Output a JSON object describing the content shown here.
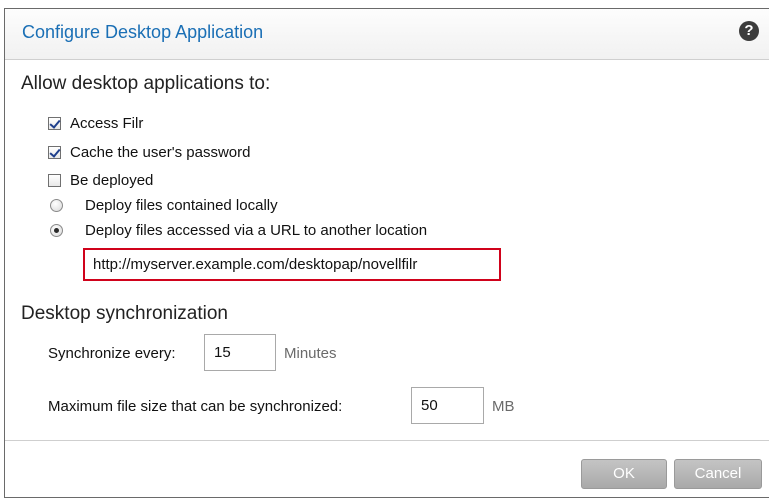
{
  "dialog": {
    "title": "Configure Desktop Application",
    "help_icon": "help-icon"
  },
  "allow_section": {
    "heading": "Allow desktop applications to:",
    "options": [
      {
        "label": "Access Filr",
        "type": "checkbox",
        "checked": true
      },
      {
        "label": "Cache the user's password",
        "type": "checkbox",
        "checked": true
      },
      {
        "label": "Be deployed",
        "type": "checkbox",
        "checked": false
      },
      {
        "label": "Deploy files contained locally",
        "type": "radio",
        "checked": false
      },
      {
        "label": "Deploy files accessed via a URL to another location",
        "type": "radio",
        "checked": true
      }
    ],
    "deploy_url": "http://myserver.example.com/desktopap/novellfilr",
    "highlight_color": "#d0021b"
  },
  "sync_section": {
    "heading": "Desktop synchronization",
    "interval_label": "Synchronize every:",
    "interval_value": "15",
    "interval_unit": "Minutes",
    "max_size_label": "Maximum file size that can be synchronized:",
    "max_size_value": "50",
    "max_size_unit": "MB"
  },
  "footer": {
    "ok_label": "OK",
    "cancel_label": "Cancel"
  },
  "colors": {
    "title": "#1a6fb5",
    "button_bg": "#b5b5b5"
  }
}
